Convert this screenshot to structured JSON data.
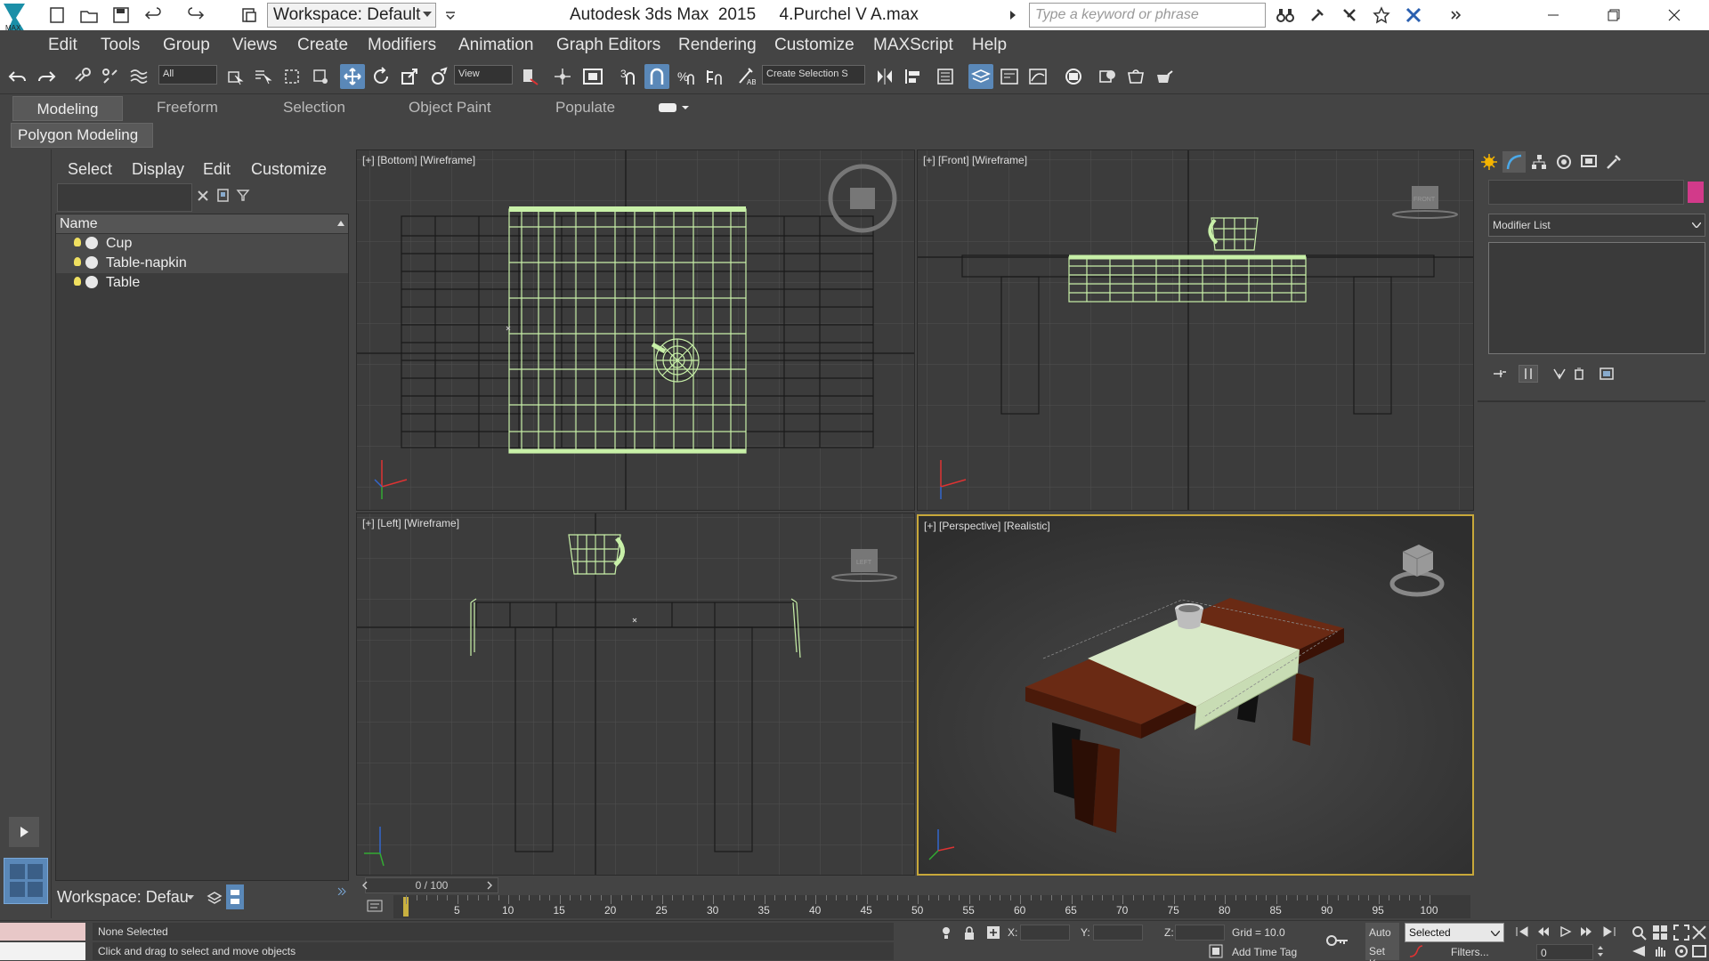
{
  "titlebar": {
    "workspace": "Workspace: Default",
    "title": "Autodesk 3ds Max  2015     4.Purchel V A.max",
    "search_placeholder": "Type a keyword or phrase"
  },
  "menu": [
    "Edit",
    "Tools",
    "Group",
    "Views",
    "Create",
    "Modifiers",
    "Animation",
    "Graph Editors",
    "Rendering",
    "Customize",
    "MAXScript",
    "Help"
  ],
  "toolbar": {
    "selection_filter": "All",
    "ref_coord": "View",
    "named_selection": "Create Selection S"
  },
  "ribbon": {
    "tabs": [
      "Modeling",
      "Freeform",
      "Selection",
      "Object Paint",
      "Populate"
    ],
    "panel": "Polygon Modeling"
  },
  "scene_explorer": {
    "menu": [
      "Select",
      "Display",
      "Edit",
      "Customize"
    ],
    "column": "Name",
    "items": [
      "Cup",
      "Table-napkin",
      "Table"
    ],
    "workspace": "Workspace: Defau"
  },
  "viewports": {
    "top_left": "[+] [Bottom] [Wireframe]",
    "top_right": "[+] [Front] [Wireframe]",
    "bottom_left": "[+] [Left] [Wireframe]",
    "bottom_right": "[+] [Perspective] [Realistic]"
  },
  "command_panel": {
    "modifier_list": "Modifier List",
    "object_color": "#d23a8a"
  },
  "timeline": {
    "frame": "0 / 100",
    "ticks": [
      "5",
      "10",
      "15",
      "20",
      "25",
      "30",
      "35",
      "40",
      "45",
      "50",
      "55",
      "60",
      "65",
      "70",
      "75",
      "80",
      "85",
      "90",
      "95",
      "100"
    ]
  },
  "status": {
    "selection": "None Selected",
    "hint": "Click and drag to select and move objects",
    "x_label": "X:",
    "y_label": "Y:",
    "z_label": "Z:",
    "grid": "Grid = 10.0",
    "add_time_tag": "Add Time Tag",
    "auto": "Auto",
    "set_key": "Set K.",
    "selected": "Selected",
    "filters": "Filters...",
    "frame_value": "0"
  },
  "colors": {
    "wire_green": "#c8f0a8",
    "table_brown": "#6a2a14",
    "napkin": "#d8e8c8",
    "active_viewport": "#c8a83a"
  }
}
